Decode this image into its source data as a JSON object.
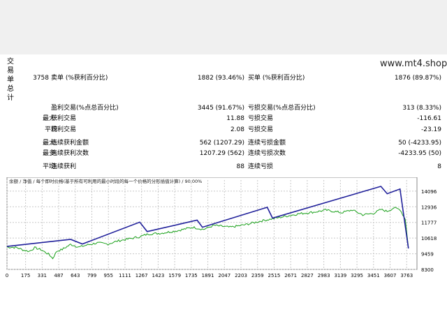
{
  "report": {
    "side_label": "交易单总计",
    "watermark": "www.mt4.shop",
    "rows": [
      {
        "a": "",
        "b": "3758",
        "c": "卖单 (%获利百分比)",
        "d": "1882 (93.46%)",
        "e": "买单 (%获利百分比)",
        "f": "1876 (89.87%)"
      },
      {
        "a": "",
        "b": "",
        "c": "盈利交易(%点总百分比)",
        "d": "3445 (91.67%)",
        "e": "亏损交易(%点总百分比)",
        "f": "313 (8.33%)"
      },
      {
        "a": "最大:",
        "b": "",
        "c": "获利交易",
        "d": "11.88",
        "e": "亏损交易",
        "f": "-116.61"
      },
      {
        "a": "平均",
        "b": "",
        "c": "获利交易",
        "d": "2.08",
        "e": "亏损交易",
        "f": "-23.19"
      },
      {
        "a": "最大:",
        "b": "",
        "c": "连续获利金额",
        "d": "562 (1207.29)",
        "e": "连续亏损金额",
        "f": "50 (-4233.95)"
      },
      {
        "a": "最多:",
        "b": "",
        "c": "连续获利次数",
        "d": "1207.29 (562)",
        "e": "连续亏损次数",
        "f": "-4233.95 (50)"
      },
      {
        "a": "平均:",
        "b": "",
        "c": "连续获利",
        "d": "88",
        "e": "连续亏损",
        "f": "8"
      }
    ]
  },
  "chart_legend": "余额 / 净值 / 每个即时价格(基于所有可利用的最小时段的每一个价格的分形插值计算) / 90.00%",
  "colors": {
    "balance": "#1f1f9a",
    "equity": "#1aa01a",
    "grid": "#c8c8c8"
  },
  "chart_data": {
    "type": "line",
    "x_ticks": [
      "0",
      "175",
      "331",
      "487",
      "643",
      "799",
      "955",
      "1111",
      "1267",
      "1423",
      "1579",
      "1735",
      "1891",
      "2047",
      "2203",
      "2359",
      "2515",
      "2671",
      "2827",
      "2983",
      "3139",
      "3295",
      "3451",
      "3607",
      "3763"
    ],
    "y_ticks": [
      "14096",
      "12936",
      "11777",
      "10618",
      "9459",
      "8300"
    ],
    "ylim": [
      8300,
      14500
    ],
    "xlim": [
      0,
      3860
    ],
    "series": [
      {
        "name": "余额",
        "points": [
          [
            0,
            10000
          ],
          [
            600,
            10520
          ],
          [
            710,
            10180
          ],
          [
            1250,
            11800
          ],
          [
            1320,
            11100
          ],
          [
            1790,
            11950
          ],
          [
            1840,
            11420
          ],
          [
            2450,
            12900
          ],
          [
            2500,
            12100
          ],
          [
            3520,
            14450
          ],
          [
            3580,
            13900
          ],
          [
            3700,
            14250
          ],
          [
            3780,
            9850
          ]
        ]
      },
      {
        "name": "净值",
        "points": [
          [
            0,
            9960
          ],
          [
            90,
            9920
          ],
          [
            160,
            9720
          ],
          [
            210,
            9640
          ],
          [
            260,
            9900
          ],
          [
            320,
            9760
          ],
          [
            400,
            9380
          ],
          [
            430,
            9120
          ],
          [
            470,
            9650
          ],
          [
            520,
            9780
          ],
          [
            600,
            10150
          ],
          [
            680,
            9950
          ],
          [
            760,
            10120
          ],
          [
            850,
            10260
          ],
          [
            950,
            10180
          ],
          [
            1050,
            10420
          ],
          [
            1150,
            10560
          ],
          [
            1250,
            10720
          ],
          [
            1330,
            10920
          ],
          [
            1450,
            10980
          ],
          [
            1600,
            11160
          ],
          [
            1750,
            11420
          ],
          [
            1850,
            11260
          ],
          [
            1950,
            11560
          ],
          [
            2100,
            11420
          ],
          [
            2250,
            11620
          ],
          [
            2400,
            11900
          ],
          [
            2500,
            12050
          ],
          [
            2600,
            12200
          ],
          [
            2750,
            12420
          ],
          [
            2900,
            12550
          ],
          [
            3000,
            12690
          ],
          [
            3150,
            12500
          ],
          [
            3250,
            12700
          ],
          [
            3350,
            12340
          ],
          [
            3450,
            12450
          ],
          [
            3520,
            12730
          ],
          [
            3580,
            12600
          ],
          [
            3640,
            12850
          ],
          [
            3700,
            12750
          ],
          [
            3750,
            12000
          ],
          [
            3780,
            9900
          ]
        ]
      }
    ]
  }
}
